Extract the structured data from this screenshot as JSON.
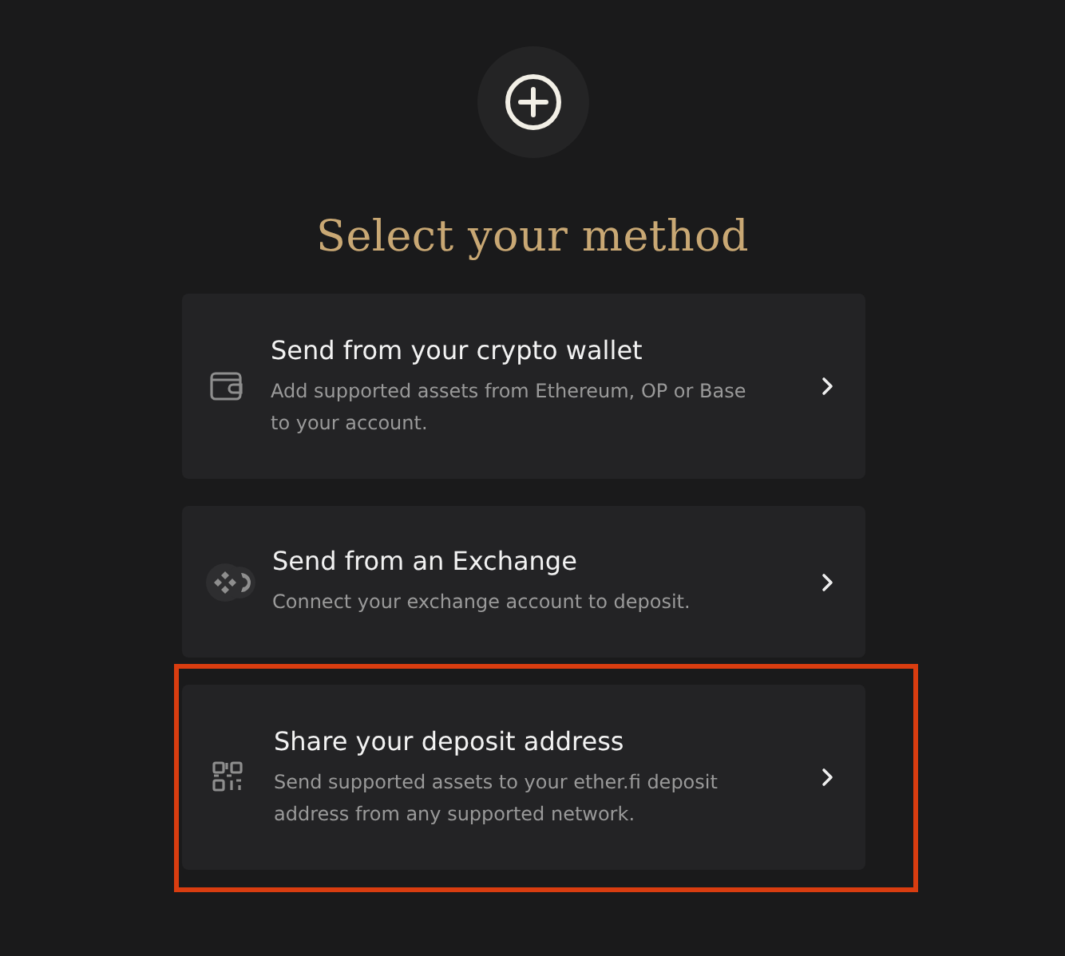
{
  "title": "Select your method",
  "options": [
    {
      "kind": "wallet",
      "title": "Send from your crypto wallet",
      "description": "Add supported assets from Ethereum, OP or Base to your account.",
      "highlighted": false
    },
    {
      "kind": "exchange",
      "title": "Send from an Exchange",
      "description": "Connect your exchange account to deposit.",
      "highlighted": false
    },
    {
      "kind": "qr",
      "title": "Share your deposit address",
      "description": "Send supported assets to your ether.fi deposit address from any supported network.",
      "highlighted": true
    }
  ]
}
